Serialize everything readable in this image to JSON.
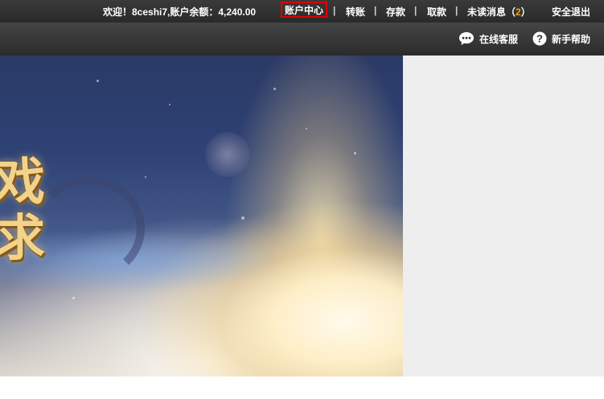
{
  "topbar": {
    "welcome": "欢迎！8ceshi7,账户余额：4,240.00",
    "account_center": "账户中心",
    "separator": "|",
    "transfer": "转账",
    "deposit": "存款",
    "withdraw": "取款",
    "unread_prefix": "未读消息（",
    "unread_count": "2",
    "unread_suffix": "）",
    "logout": "安全退出"
  },
  "subbar": {
    "online_service": "在线客服",
    "help": "新手帮助"
  },
  "banner": {
    "line1": "戏",
    "line2": "求"
  },
  "colors": {
    "topbar_bg": "#2f2f2f",
    "highlight_border": "#e00000",
    "unread_accent": "#f0a820",
    "side_panel_bg": "#eeeeee"
  },
  "icons": [
    "chat-bubble-icon",
    "question-circle-icon"
  ]
}
